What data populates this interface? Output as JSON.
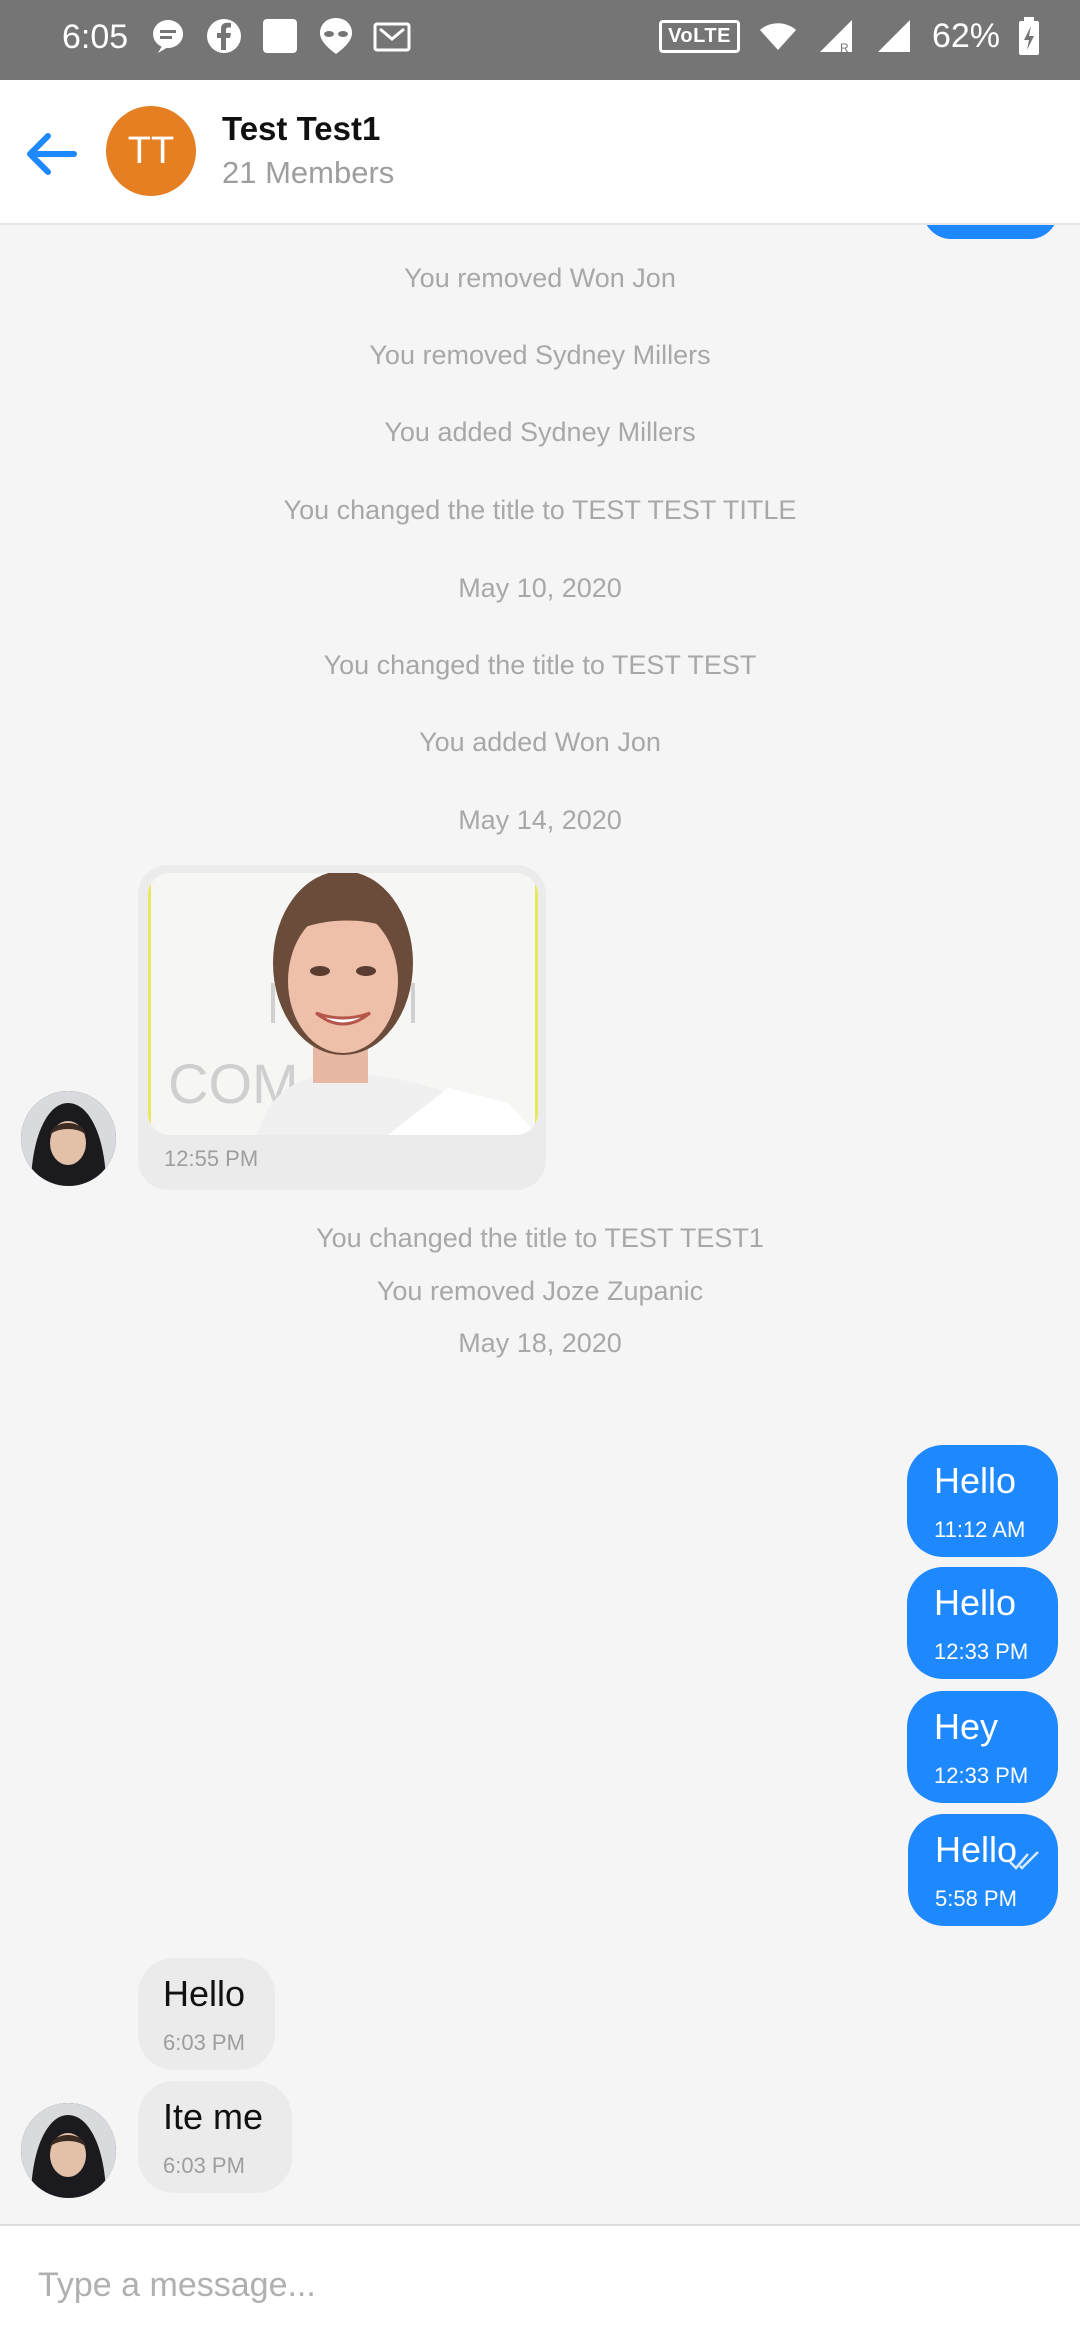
{
  "status_bar": {
    "time": "6:05",
    "network_badge": "VoLTE",
    "battery": "62%",
    "icons": [
      "message-icon",
      "facebook-icon",
      "square-icon",
      "alien-icon",
      "mail-icon",
      "wifi-icon",
      "signal-r-icon",
      "signal-icon",
      "battery-charging-icon"
    ]
  },
  "header": {
    "avatar_initials": "TT",
    "avatar_color": "#e67e22",
    "title": "Test Test1",
    "subtitle": "21 Members"
  },
  "system_messages": [
    "You removed Won Jon",
    "You removed Sydney Millers",
    "You added Sydney Millers",
    "You changed the title to TEST TEST TITLE",
    "May 10, 2020",
    "You changed the title to TEST TEST",
    "You added Won Jon",
    "May 14, 2020",
    "You changed the title to TEST TEST1",
    "You removed Joze Zupanic",
    "May 18, 2020"
  ],
  "image_message": {
    "time": "12:55 PM"
  },
  "outgoing_messages": [
    {
      "text": "Hello",
      "time": "11:12 AM"
    },
    {
      "text": "Hello",
      "time": "12:33 PM"
    },
    {
      "text": "Hey",
      "time": "12:33 PM"
    },
    {
      "text": "Hello",
      "time": "5:58 PM",
      "read_receipt": "double-check-icon"
    }
  ],
  "incoming_messages": [
    {
      "text": "Hello",
      "time": "6:03 PM"
    },
    {
      "text": "Ite me",
      "time": "6:03 PM"
    }
  ],
  "composer": {
    "placeholder": "Type a message..."
  },
  "colors": {
    "outgoing_bubble": "#1e88ff",
    "incoming_bubble": "#ebebeb",
    "accent": "#1e88ff"
  }
}
